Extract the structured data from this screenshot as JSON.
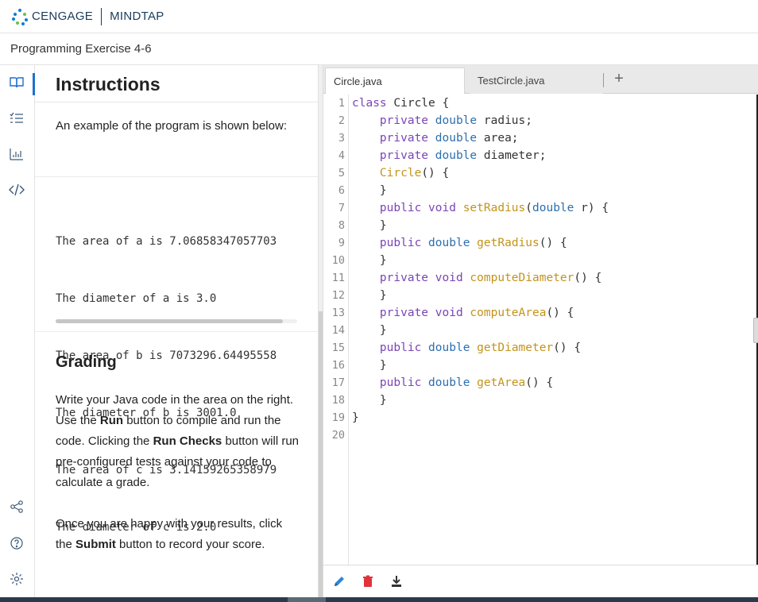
{
  "header": {
    "brand": "CENGAGE",
    "product": "MINDTAP"
  },
  "subheader": {
    "title": "Programming Exercise 4-6"
  },
  "rail": {
    "icons": [
      "book-icon",
      "checklist-icon",
      "bar-chart-icon",
      "code-icon",
      "share-icon",
      "help-icon",
      "settings-icon"
    ]
  },
  "instructions": {
    "title": "Instructions",
    "intro": "An example of the program is shown below:",
    "sample_lines": [
      "The area of a is 7.06858347057703",
      "The diameter of a is 3.0",
      "The area of b is 7073296.64495558",
      "The diameter of b is 3001.0",
      "The area of c is 3.14159265358979",
      "The diameter of c is 2.0"
    ],
    "grading_title": "Grading",
    "grading_p1": {
      "a": "Write your Java code in the area on the right. Use the ",
      "b": "Run",
      "c": " button to compile and run the code. Clicking the ",
      "d": "Run Checks",
      "e": " button will run pre-configured tests against your code to calculate a grade."
    },
    "grading_p2": {
      "a": "Once you are happy with your results, click the ",
      "b": "Submit",
      "c": " button to record your score."
    }
  },
  "editor": {
    "tabs": [
      "Circle.java",
      "TestCircle.java"
    ],
    "add_tab": "+",
    "line_numbers": [
      "1",
      "2",
      "3",
      "4",
      "5",
      "6",
      "7",
      "8",
      "9",
      "10",
      "11",
      "12",
      "13",
      "14",
      "15",
      "16",
      "17",
      "18",
      "19",
      "20"
    ],
    "code_lines": [
      "class Circle {",
      "    private double radius;",
      "    private double area;",
      "    private double diameter;",
      "    Circle() {",
      "    }",
      "    public void setRadius(double r) {",
      "    }",
      "    public double getRadius() {",
      "    }",
      "    private void computeDiameter() {",
      "    }",
      "    private void computeArea() {",
      "    }",
      "    public double getDiameter() {",
      "    }",
      "    public double getArea() {",
      "    }",
      "}",
      ""
    ],
    "toolbar_icons": [
      "pencil-icon",
      "trash-icon",
      "download-icon"
    ]
  },
  "colors": {
    "accent": "#1f6fd1",
    "keyword": "#7a45b5",
    "type": "#2d6fb0",
    "function": "#c3941a",
    "trash": "#e0323a"
  }
}
